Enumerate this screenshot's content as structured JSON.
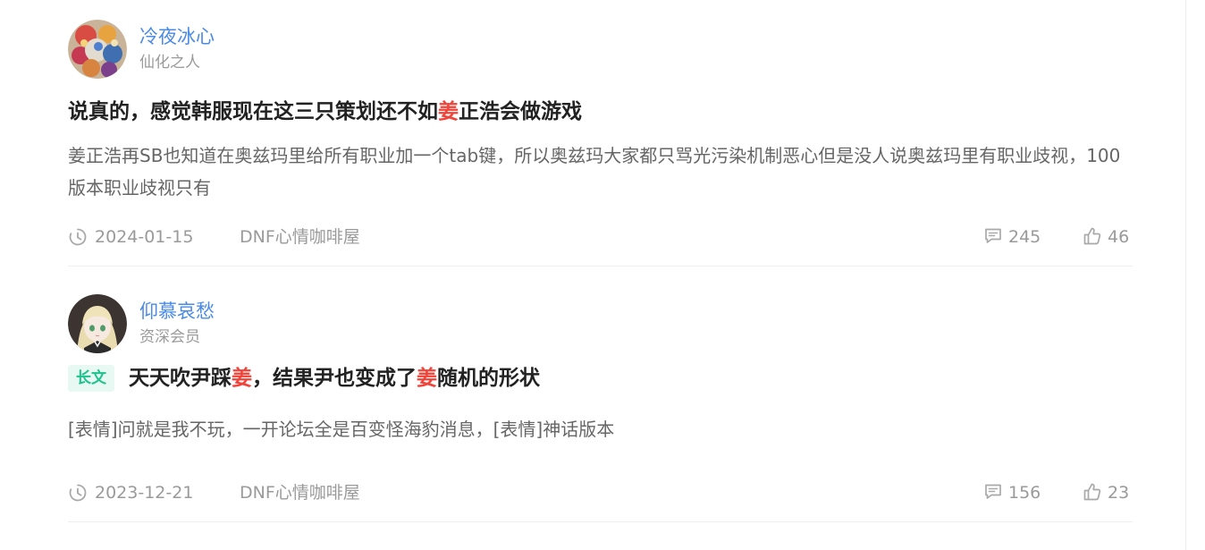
{
  "posts": [
    {
      "author": {
        "name": "冷夜冰心",
        "title": "仙化之人"
      },
      "tag": "",
      "title": {
        "before": "说真的，感觉韩服现在这三只策划还不如",
        "keyword": "姜",
        "after": "正浩会做游戏"
      },
      "body": "姜正浩再SB也知道在奥兹玛里给所有职业加一个tab键，所以奥兹玛大家都只骂光污染机制恶心但是没人说奥兹玛里有职业歧视，100版本职业歧视只有",
      "date": "2024-01-15",
      "forum": "DNF心情咖啡屋",
      "comments": "245",
      "likes": "46"
    },
    {
      "author": {
        "name": "仰慕哀愁",
        "title": "资深会员"
      },
      "tag": "长文",
      "title": {
        "part1": "天天吹尹踩",
        "keyword1": "姜",
        "part2": "，结果尹也变成了",
        "keyword2": "姜",
        "part3": "随机的形状"
      },
      "body": "[表情]问就是我不玩，一开论坛全是百变怪海豹消息，[表情]神话版本",
      "date": "2023-12-21",
      "forum": "DNF心情咖啡屋",
      "comments": "156",
      "likes": "23"
    }
  ],
  "colors": {
    "author_name": "#4a8ae6",
    "keyword_highlight": "#f0443a",
    "tag_text": "#1ec28c",
    "tag_bg": "#e8f9f3",
    "meta_text": "#9a9a9a",
    "body_text": "#666666",
    "title_text": "#222222"
  },
  "icons": {
    "date": "clock-icon",
    "comments": "comment-icon",
    "likes": "thumbs-up-icon"
  }
}
